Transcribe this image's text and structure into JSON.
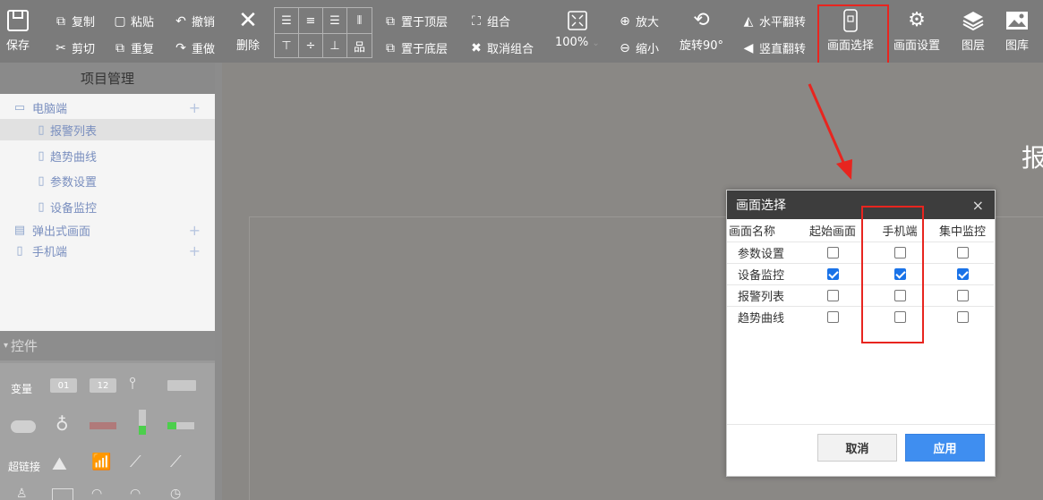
{
  "toolbar": {
    "save": "保存",
    "copy": "复制",
    "paste": "粘贴",
    "undo": "撤销",
    "cut": "剪切",
    "repeat": "重复",
    "redo": "重做",
    "delete": "删除",
    "bring_top": "置于顶层",
    "group": "组合",
    "send_bottom": "置于底层",
    "ungroup": "取消组合",
    "zoom_value": "100%",
    "zoom_in": "放大",
    "zoom_out": "缩小",
    "rotate": "旋转90°",
    "flip_h": "水平翻转",
    "flip_v": "竖直翻转",
    "screen_select": "画面选择",
    "screen_settings": "画面设置",
    "layers": "图层",
    "gallery": "图库"
  },
  "sidebar": {
    "project_title": "项目管理",
    "tree": [
      {
        "label": "电脑端",
        "type": "group"
      },
      {
        "label": "报警列表",
        "type": "page",
        "selected": true
      },
      {
        "label": "趋势曲线",
        "type": "page"
      },
      {
        "label": "参数设置",
        "type": "page"
      },
      {
        "label": "设备监控",
        "type": "page"
      },
      {
        "label": "弹出式画面",
        "type": "group"
      },
      {
        "label": "手机端",
        "type": "group"
      }
    ],
    "controls_title": "控件",
    "control_labels": {
      "variable": "变量",
      "hyperlink": "超链接"
    },
    "control_badges": {
      "a": "01",
      "b": "12"
    }
  },
  "canvas": {
    "partial_text": "报"
  },
  "dialog": {
    "title": "画面选择",
    "close": "×",
    "columns": [
      "画面名称",
      "起始画面",
      "手机端",
      "集中监控"
    ],
    "rows": [
      {
        "name": "参数设置",
        "start": false,
        "mobile": false,
        "central": false
      },
      {
        "name": "设备监控",
        "start": true,
        "mobile": true,
        "central": true
      },
      {
        "name": "报警列表",
        "start": false,
        "mobile": false,
        "central": false
      },
      {
        "name": "趋势曲线",
        "start": false,
        "mobile": false,
        "central": false
      }
    ],
    "cancel": "取消",
    "apply": "应用"
  },
  "colors": {
    "highlight": "#e8251f",
    "accent": "#3f8ef0",
    "check": "#1a73e8"
  }
}
